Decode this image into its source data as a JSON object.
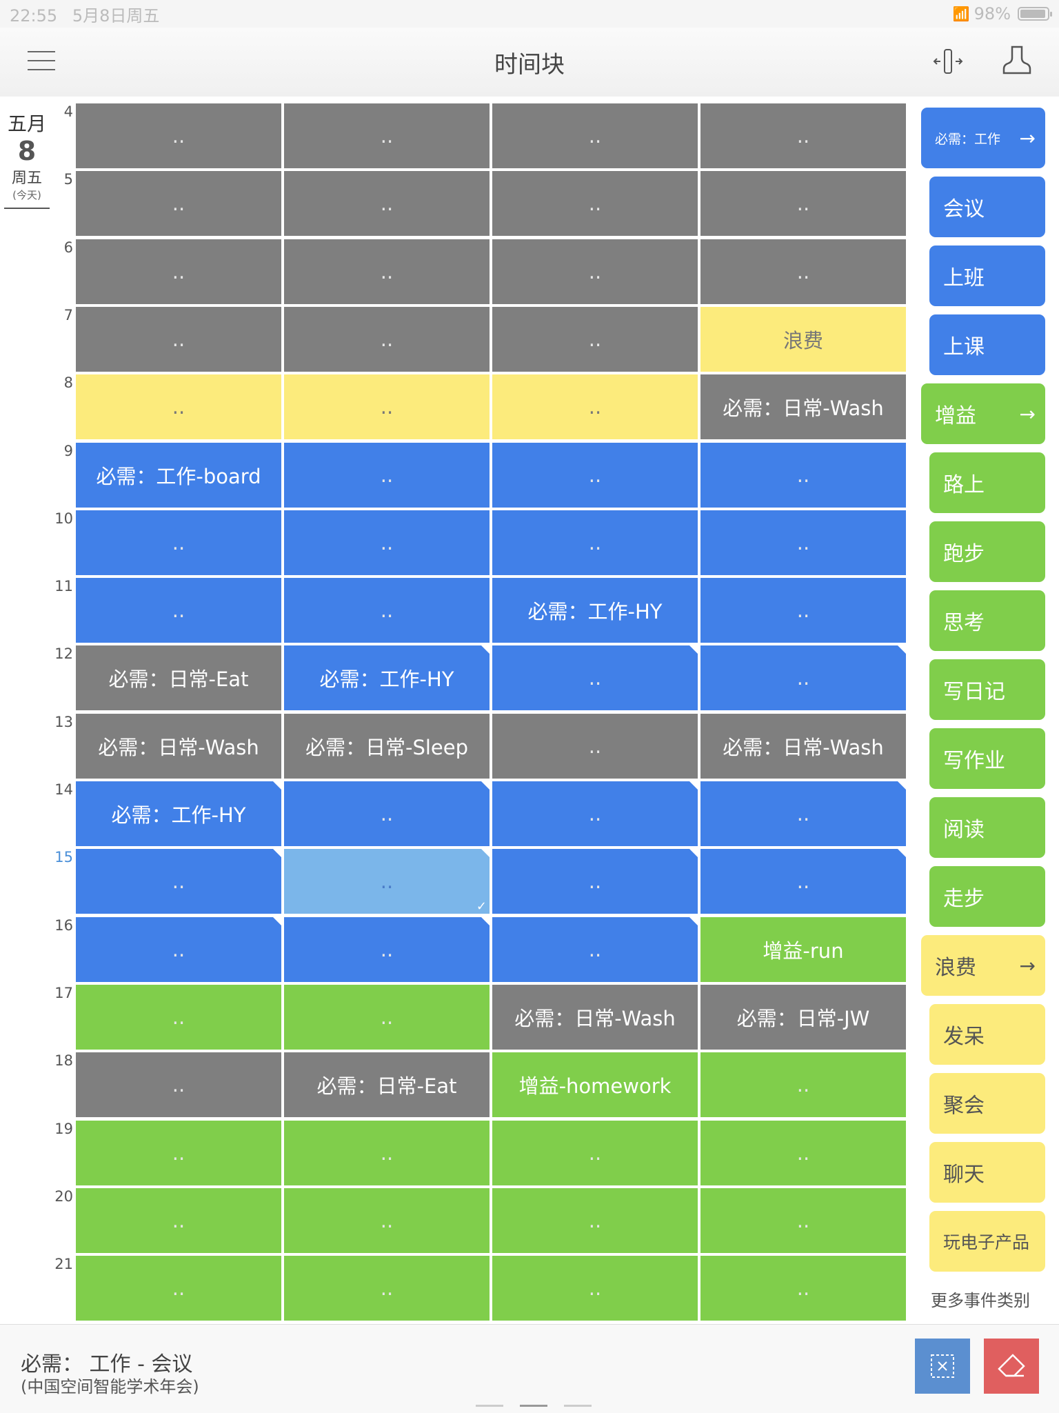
{
  "status_bar": {
    "time": "22:55",
    "date": "5月8日周五",
    "battery": "98%"
  },
  "nav": {
    "title": "时间块"
  },
  "date": {
    "month": "五月",
    "day": "8",
    "weekday": "周五",
    "today": "(今天)"
  },
  "hours": [
    "4",
    "5",
    "6",
    "7",
    "8",
    "9",
    "10",
    "11",
    "12",
    "13",
    "14",
    "15",
    "16",
    "17",
    "18",
    "19",
    "20",
    "21"
  ],
  "current_hour": "15",
  "grid": [
    [
      {
        "t": "..",
        "c": "gray"
      },
      {
        "t": "..",
        "c": "gray"
      },
      {
        "t": "..",
        "c": "gray"
      },
      {
        "t": "..",
        "c": "gray"
      }
    ],
    [
      {
        "t": "..",
        "c": "gray"
      },
      {
        "t": "..",
        "c": "gray"
      },
      {
        "t": "..",
        "c": "gray"
      },
      {
        "t": "..",
        "c": "gray"
      }
    ],
    [
      {
        "t": "..",
        "c": "gray"
      },
      {
        "t": "..",
        "c": "gray"
      },
      {
        "t": "..",
        "c": "gray"
      },
      {
        "t": "..",
        "c": "gray"
      }
    ],
    [
      {
        "t": "..",
        "c": "gray"
      },
      {
        "t": "..",
        "c": "gray"
      },
      {
        "t": "..",
        "c": "gray"
      },
      {
        "t": "浪费",
        "c": "yellow"
      }
    ],
    [
      {
        "t": "..",
        "c": "yellow"
      },
      {
        "t": "..",
        "c": "yellow"
      },
      {
        "t": "..",
        "c": "yellow"
      },
      {
        "t": "必需：日常-Wash",
        "c": "gray"
      }
    ],
    [
      {
        "t": "必需：工作-board",
        "c": "blue"
      },
      {
        "t": "..",
        "c": "blue"
      },
      {
        "t": "..",
        "c": "blue"
      },
      {
        "t": "..",
        "c": "blue"
      }
    ],
    [
      {
        "t": "..",
        "c": "blue"
      },
      {
        "t": "..",
        "c": "blue"
      },
      {
        "t": "..",
        "c": "blue"
      },
      {
        "t": "..",
        "c": "blue"
      }
    ],
    [
      {
        "t": "..",
        "c": "blue"
      },
      {
        "t": "..",
        "c": "blue"
      },
      {
        "t": "必需：工作-HY",
        "c": "blue"
      },
      {
        "t": "..",
        "c": "blue"
      }
    ],
    [
      {
        "t": "必需：日常-Eat",
        "c": "gray"
      },
      {
        "t": "必需：工作-HY",
        "c": "blue",
        "n": 1
      },
      {
        "t": "..",
        "c": "blue",
        "n": 1
      },
      {
        "t": "..",
        "c": "blue",
        "n": 1
      }
    ],
    [
      {
        "t": "必需：日常-Wash",
        "c": "gray"
      },
      {
        "t": "必需：日常-Sleep",
        "c": "gray"
      },
      {
        "t": "..",
        "c": "gray"
      },
      {
        "t": "必需：日常-Wash",
        "c": "gray"
      }
    ],
    [
      {
        "t": "必需：工作-HY",
        "c": "blue",
        "n": 1
      },
      {
        "t": "..",
        "c": "blue",
        "n": 1
      },
      {
        "t": "..",
        "c": "blue",
        "n": 1
      },
      {
        "t": "..",
        "c": "blue",
        "n": 1
      }
    ],
    [
      {
        "t": "..",
        "c": "blue",
        "n": 1
      },
      {
        "t": "..",
        "c": "sel",
        "n": 1,
        "check": 1
      },
      {
        "t": "..",
        "c": "blue",
        "n": 1
      },
      {
        "t": "..",
        "c": "blue",
        "n": 1
      }
    ],
    [
      {
        "t": "..",
        "c": "blue",
        "n": 1
      },
      {
        "t": "..",
        "c": "blue",
        "n": 1
      },
      {
        "t": "..",
        "c": "blue",
        "n": 1
      },
      {
        "t": "增益-run",
        "c": "green"
      }
    ],
    [
      {
        "t": "..",
        "c": "green"
      },
      {
        "t": "..",
        "c": "green"
      },
      {
        "t": "必需：日常-Wash",
        "c": "gray"
      },
      {
        "t": "必需：日常-JW",
        "c": "gray"
      }
    ],
    [
      {
        "t": "..",
        "c": "gray"
      },
      {
        "t": "必需：日常-Eat",
        "c": "gray"
      },
      {
        "t": "增益-homework",
        "c": "green"
      },
      {
        "t": "..",
        "c": "green"
      }
    ],
    [
      {
        "t": "..",
        "c": "green"
      },
      {
        "t": "..",
        "c": "green"
      },
      {
        "t": "..",
        "c": "green"
      },
      {
        "t": "..",
        "c": "green"
      }
    ],
    [
      {
        "t": "..",
        "c": "green"
      },
      {
        "t": "..",
        "c": "green"
      },
      {
        "t": "..",
        "c": "green"
      },
      {
        "t": "..",
        "c": "green"
      }
    ],
    [
      {
        "t": "..",
        "c": "green"
      },
      {
        "t": "..",
        "c": "green"
      },
      {
        "t": "..",
        "c": "green"
      },
      {
        "t": "..",
        "c": "green"
      }
    ]
  ],
  "categories": [
    {
      "label": "必需：工作",
      "color": "blue",
      "header": true,
      "small": true
    },
    {
      "label": "会议",
      "color": "blue"
    },
    {
      "label": "上班",
      "color": "blue"
    },
    {
      "label": "上课",
      "color": "blue"
    },
    {
      "label": "增益",
      "color": "green",
      "header": true
    },
    {
      "label": "路上",
      "color": "green"
    },
    {
      "label": "跑步",
      "color": "green"
    },
    {
      "label": "思考",
      "color": "green"
    },
    {
      "label": "写日记",
      "color": "green"
    },
    {
      "label": "写作业",
      "color": "green"
    },
    {
      "label": "阅读",
      "color": "green"
    },
    {
      "label": "走步",
      "color": "green"
    },
    {
      "label": "浪费",
      "color": "yellow",
      "header": true
    },
    {
      "label": "发呆",
      "color": "yellow"
    },
    {
      "label": "聚会",
      "color": "yellow"
    },
    {
      "label": "聊天",
      "color": "yellow"
    },
    {
      "label": "玩电子产品",
      "color": "yellow",
      "tight": true
    }
  ],
  "more_categories": "更多事件类别",
  "selection": {
    "title": "必需：  工作 - 会议",
    "detail": "(中国空间智能学术年会)"
  },
  "colors": {
    "gray": "#7f7f7f",
    "blue": "#4180e8",
    "green": "#80ce4b",
    "yellow": "#fceb7c",
    "selected": "#7bb6ea",
    "erase": "#e05f5f"
  }
}
